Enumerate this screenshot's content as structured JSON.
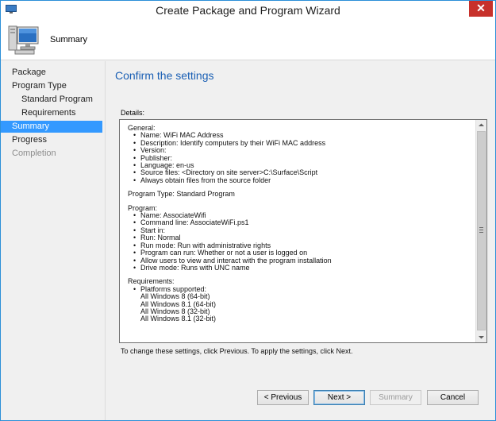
{
  "window": {
    "title": "Create Package and Program Wizard",
    "close_label": "✕",
    "accent_color": "#2b8fd8",
    "close_color": "#c7312b"
  },
  "header": {
    "title": "Summary",
    "icon": "computer-monitor-icon"
  },
  "sidebar": {
    "items": [
      {
        "label": "Package",
        "level": 1,
        "state": "normal"
      },
      {
        "label": "Program Type",
        "level": 1,
        "state": "normal"
      },
      {
        "label": "Standard Program",
        "level": 2,
        "state": "normal"
      },
      {
        "label": "Requirements",
        "level": 2,
        "state": "normal"
      },
      {
        "label": "Summary",
        "level": 1,
        "state": "selected"
      },
      {
        "label": "Progress",
        "level": 1,
        "state": "normal"
      },
      {
        "label": "Completion",
        "level": 1,
        "state": "disabled"
      }
    ],
    "selected_color": "#3399ff"
  },
  "main": {
    "heading": "Confirm the settings",
    "details_label": "Details:",
    "details": {
      "general_header": "General:",
      "general_items": [
        "Name: WiFi MAC Address",
        "Description: Identify computers by their WiFi MAC address",
        "Version:",
        "Publisher:",
        "Language: en-us",
        "Source files: <Directory on site server>C:\\Surface\\Script",
        "Always obtain files from the source folder"
      ],
      "program_type": "Program Type: Standard Program",
      "program_header": "Program:",
      "program_items": [
        "Name: AssociateWifi",
        "Command line: AssociateWiFi.ps1",
        "Start in:",
        "Run: Normal",
        "Run mode: Run with administrative rights",
        "Program can run: Whether or not a user is logged on",
        "Allow users to view and interact with the program installation",
        "Drive mode: Runs with UNC name"
      ],
      "requirements_header": "Requirements:",
      "requirements_items": [
        "Platforms supported:"
      ],
      "platforms": [
        "All Windows 8 (64-bit)",
        "All Windows 8.1 (64-bit)",
        "All Windows 8 (32-bit)",
        "All Windows 8.1 (32-bit)"
      ]
    },
    "footer_note": "To change these settings, click Previous. To apply the settings, click Next."
  },
  "buttons": {
    "previous": "< Previous",
    "next": "Next >",
    "summary": "Summary",
    "cancel": "Cancel"
  }
}
